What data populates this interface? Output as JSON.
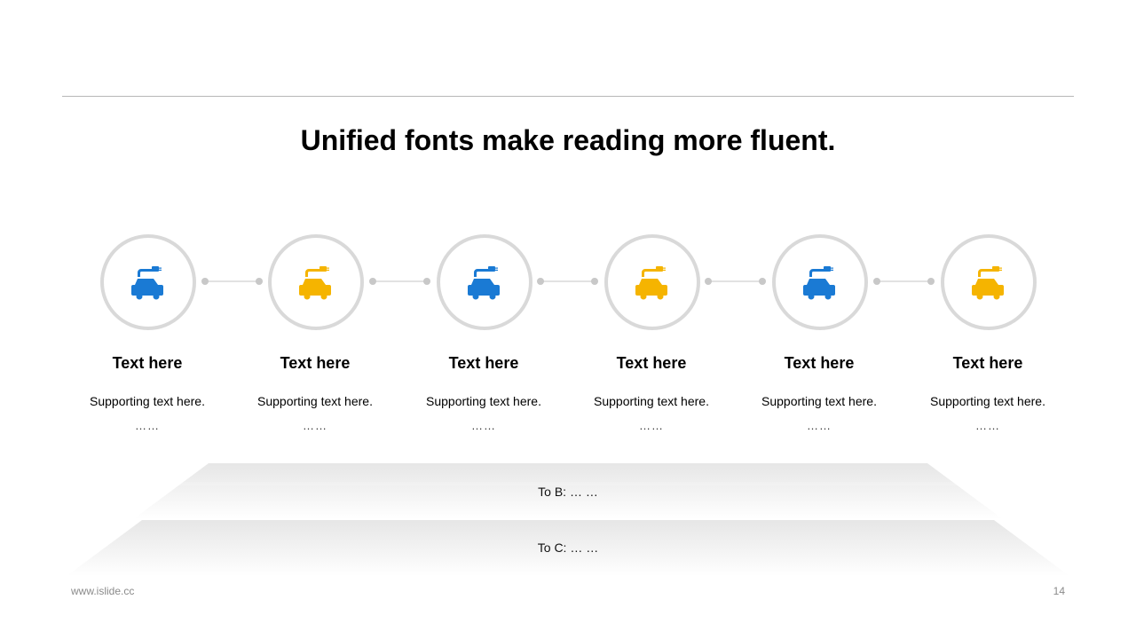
{
  "header": {
    "title": "Unified fonts make reading more fluent."
  },
  "steps": [
    {
      "title": "Text here",
      "subtitle": "Supporting text here.",
      "ellipsis": "……",
      "icon": "car-charging-icon",
      "color": "#1a7ad4"
    },
    {
      "title": "Text here",
      "subtitle": "Supporting text here.",
      "ellipsis": "……",
      "icon": "car-charging-icon",
      "color": "#f5b400"
    },
    {
      "title": "Text here",
      "subtitle": "Supporting text here.",
      "ellipsis": "……",
      "icon": "car-charging-icon",
      "color": "#1a7ad4"
    },
    {
      "title": "Text here",
      "subtitle": "Supporting text here.",
      "ellipsis": "……",
      "icon": "car-charging-icon",
      "color": "#f5b400"
    },
    {
      "title": "Text here",
      "subtitle": "Supporting text here.",
      "ellipsis": "……",
      "icon": "car-charging-icon",
      "color": "#1a7ad4"
    },
    {
      "title": "Text here",
      "subtitle": "Supporting text here.",
      "ellipsis": "……",
      "icon": "car-charging-icon",
      "color": "#f5b400"
    }
  ],
  "bands": [
    {
      "label": "To B: … …"
    },
    {
      "label": "To C: … …"
    }
  ],
  "footer": {
    "website": "www.islide.cc",
    "page_number": "14"
  }
}
